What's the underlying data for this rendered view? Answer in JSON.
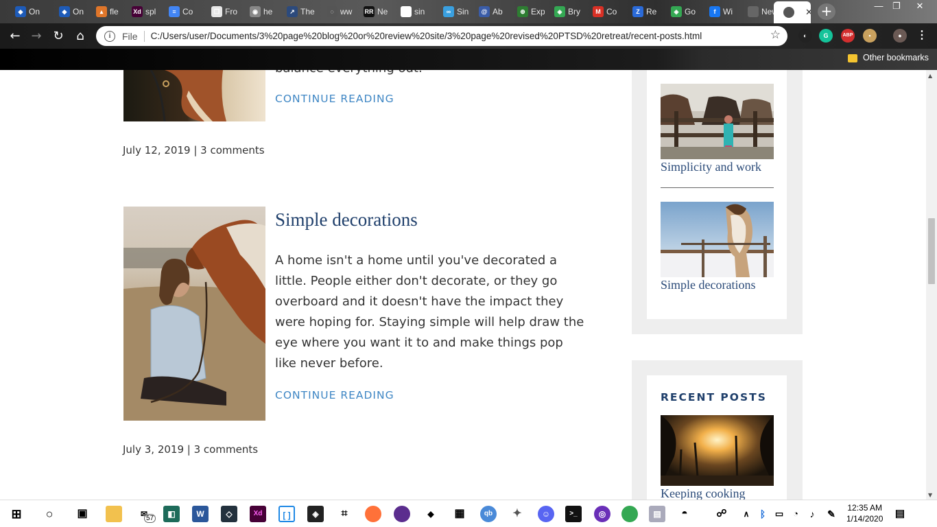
{
  "browser": {
    "tabs": [
      {
        "label": "On",
        "color": "#1e5bb8",
        "glyph": "◆"
      },
      {
        "label": "On",
        "color": "#1e5bb8",
        "glyph": "◆"
      },
      {
        "label": "fle",
        "color": "#e0762a",
        "glyph": "▴"
      },
      {
        "label": "spl",
        "color": "#470137",
        "glyph": "Xd"
      },
      {
        "label": "Co",
        "color": "#4285f4",
        "glyph": "≡"
      },
      {
        "label": "Fro",
        "color": "#e8e8e8",
        "glyph": "❐"
      },
      {
        "label": "he",
        "color": "#888888",
        "glyph": "◉"
      },
      {
        "label": "The",
        "color": "#2c4a7c",
        "glyph": "↗"
      },
      {
        "label": "ww",
        "color": "#555555",
        "glyph": "◌"
      },
      {
        "label": "Ne",
        "color": "#111111",
        "glyph": "RR"
      },
      {
        "label": "sin",
        "color": "#ffffff",
        "glyph": "G"
      },
      {
        "label": "Sin",
        "color": "#3aa0e0",
        "glyph": "∞"
      },
      {
        "label": "Ab",
        "color": "#3a5ca8",
        "glyph": "@"
      },
      {
        "label": "Exp",
        "color": "#2e7d32",
        "glyph": "⊕"
      },
      {
        "label": "Bry",
        "color": "#34a853",
        "glyph": "◈"
      },
      {
        "label": "Co",
        "color": "#d93025",
        "glyph": "M"
      },
      {
        "label": "Re",
        "color": "#2a6ad8",
        "glyph": "Z"
      },
      {
        "label": "Go",
        "color": "#34a853",
        "glyph": "◈"
      },
      {
        "label": "Wi",
        "color": "#1877f2",
        "glyph": "f"
      },
      {
        "label": "New Ta",
        "color": "#666666",
        "glyph": ""
      }
    ],
    "active_tab_close": "✕",
    "new_tab": "+",
    "window_controls": {
      "minimize": "—",
      "restore": "❐",
      "close": "✕"
    },
    "omnibox": {
      "scheme_label": "File",
      "url": "C:/Users/user/Documents/3%20page%20blog%20or%20review%20site/3%20page%20revised%20PTSD%20retreat/recent-posts.html"
    },
    "extensions": [
      {
        "name": "dark-mode-icon",
        "color": "#222222",
        "glyph": "◐"
      },
      {
        "name": "grammarly-icon",
        "color": "#15c39a",
        "glyph": "G"
      },
      {
        "name": "adblock-icon",
        "color": "#d32f2f",
        "glyph": "ABP"
      },
      {
        "name": "extension-icon",
        "color": "#c9a15e",
        "glyph": "▪"
      },
      {
        "name": "profile-avatar-icon",
        "color": "#6b5a55",
        "glyph": "●"
      }
    ],
    "bookmarks": {
      "other": "Other bookmarks"
    }
  },
  "page": {
    "post1": {
      "excerpt_tail": "balance everything out.",
      "continue": "CONTINUE READING",
      "date": "July 12, 2019",
      "separator": "|",
      "comments": "3 comments"
    },
    "post2": {
      "title": "Simple decorations",
      "excerpt": "A home isn't a home until you've decorated a little. People either don't decorate, or they go overboard and it doesn't have the impact they were hoping for. Staying simple will help draw the eye where you want it to and make things pop like never before.",
      "continue": "CONTINUE READING",
      "date": "July 3, 2019",
      "separator": "|",
      "comments": "3 comments"
    },
    "sidebar": {
      "widget1": {
        "items": [
          {
            "caption": "Simplicity and work"
          },
          {
            "caption": "Simple decorations"
          }
        ]
      },
      "widget2": {
        "heading": "RECENT POSTS",
        "items": [
          {
            "caption": "Keeping cooking"
          }
        ]
      }
    }
  },
  "taskbar": {
    "badge": "57",
    "time": "12:35 AM",
    "date": "1/14/2020"
  }
}
